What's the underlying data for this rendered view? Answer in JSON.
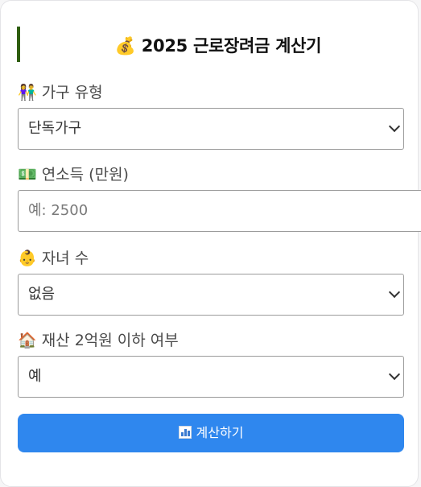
{
  "header": {
    "title_icon": "money-bag-icon",
    "title": "💰 2025 근로장려금 계산기"
  },
  "form": {
    "household_type": {
      "icon": "family-icon",
      "label": "👫 가구 유형",
      "value": "단독가구"
    },
    "annual_income": {
      "icon": "money-icon",
      "label": "💵 연소득 (만원)",
      "placeholder": "예: 2500"
    },
    "children": {
      "icon": "baby-icon",
      "label": "👶 자녀 수",
      "value": "없음"
    },
    "assets": {
      "icon": "house-icon",
      "label": "🏠 재산 2억원 이하 여부",
      "value": "예"
    }
  },
  "action": {
    "icon": "bar-chart-icon",
    "label": "계산하기"
  },
  "colors": {
    "accent": "#2f87ee",
    "title_bar": "#2f5e10"
  }
}
